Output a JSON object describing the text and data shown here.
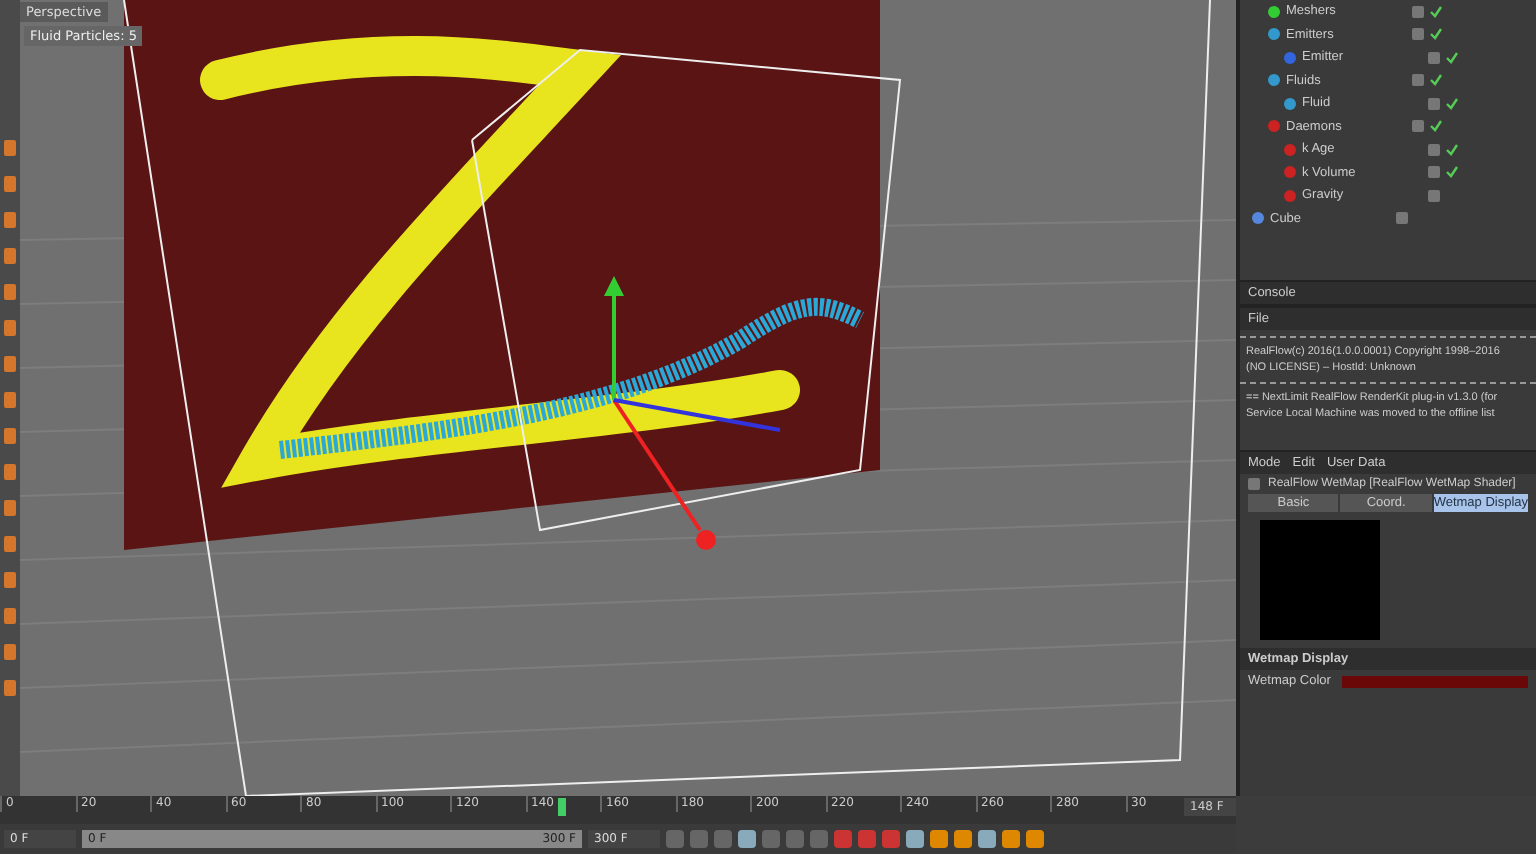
{
  "viewport": {
    "label": "Perspective",
    "hud": "Fluid Particles: 5"
  },
  "objects": {
    "scene_children": [
      {
        "name": "Meshers",
        "kind": "mesher",
        "enabled": true
      },
      {
        "name": "Emitters",
        "kind": "group",
        "enabled": true,
        "children": [
          {
            "name": "Emitter",
            "kind": "emitter",
            "enabled": true
          }
        ]
      },
      {
        "name": "Fluids",
        "kind": "group",
        "enabled": true,
        "children": [
          {
            "name": "Fluid",
            "kind": "fluid",
            "enabled": true
          }
        ]
      },
      {
        "name": "Daemons",
        "kind": "daemons",
        "enabled": true,
        "children": [
          {
            "name": "k Age",
            "kind": "daemon",
            "enabled": true
          },
          {
            "name": "k Volume",
            "kind": "daemon",
            "enabled": true
          },
          {
            "name": "Gravity",
            "kind": "gravity",
            "enabled": false
          }
        ]
      }
    ],
    "items": [
      {
        "name": "Cube",
        "kind": "cube",
        "enabled": false
      }
    ]
  },
  "console": {
    "title": "Console",
    "menu": [
      "File"
    ],
    "lines": [
      "RealFlow(c) 2016(1.0.0.0001) Copyright 1998–2016",
      "(NO LICENSE) – HostId: Unknown",
      "== NextLimit RealFlow RenderKit plug-in v1.3.0 (for",
      "Service Local Machine was moved to the offline list"
    ]
  },
  "attributes": {
    "menu": [
      "Mode",
      "Edit",
      "User Data"
    ],
    "title": "RealFlow WetMap [RealFlow WetMap Shader]",
    "tabs": [
      {
        "label": "Basic",
        "selected": false
      },
      {
        "label": "Coord.",
        "selected": false
      },
      {
        "label": "Wetmap Display",
        "selected": true
      }
    ],
    "section": "Wetmap Display",
    "field": {
      "label": "Wetmap Color",
      "color": "#6a0808"
    }
  },
  "timeline": {
    "ticks": [
      "0",
      "20",
      "40",
      "60",
      "80",
      "100",
      "120",
      "140",
      "160",
      "180",
      "200",
      "220",
      "240",
      "260",
      "280",
      "30"
    ],
    "level": 0.5,
    "current": "148 F",
    "start": "0 F",
    "range_start": "0 F",
    "range_end": "300 F",
    "end": "300 F"
  }
}
